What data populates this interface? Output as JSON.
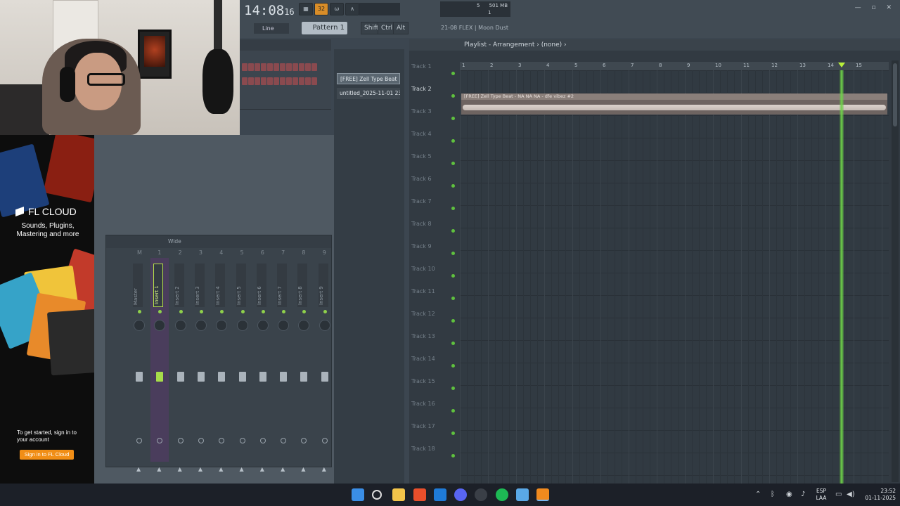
{
  "toolbar": {
    "time": "14:08",
    "time_small": "16",
    "tempo_label": "32",
    "memory": "501 MB",
    "memory_sub_1": "5",
    "memory_sub_2": "1",
    "snap": "Line",
    "pattern": "Pattern 1",
    "keys": [
      "Shift",
      "Ctrl",
      "Alt"
    ],
    "hint": "21-08  FLEX | Moon Dust"
  },
  "playlist": {
    "title": "Playlist - Arrangement",
    "subtitle": "(none)",
    "bars": [
      "1",
      "2",
      "3",
      "4",
      "5",
      "6",
      "7",
      "8",
      "9",
      "10",
      "11",
      "12",
      "13",
      "14",
      "15"
    ],
    "tracks": [
      "Track 1",
      "Track 2",
      "Track 3",
      "Track 4",
      "Track 5",
      "Track 6",
      "Track 7",
      "Track 8",
      "Track 9",
      "Track 10",
      "Track 11",
      "Track 12",
      "Track 13",
      "Track 14",
      "Track 15",
      "Track 16",
      "Track 17",
      "Track 18"
    ],
    "clip_title": "[FREE] Zell Type Beat - NA NA NA - dfe vibez #2"
  },
  "browser": {
    "items": [
      "[FREE] Zell Type Beat",
      "untitled_2025-11-01 23-"
    ]
  },
  "mixer": {
    "mode": "Wide",
    "strips": [
      {
        "num": "M",
        "name": "Master"
      },
      {
        "num": "1",
        "name": "Insert 1"
      },
      {
        "num": "2",
        "name": "Insert 2"
      },
      {
        "num": "3",
        "name": "Insert 3"
      },
      {
        "num": "4",
        "name": "Insert 4"
      },
      {
        "num": "5",
        "name": "Insert 5"
      },
      {
        "num": "6",
        "name": "Insert 6"
      },
      {
        "num": "7",
        "name": "Insert 7"
      },
      {
        "num": "8",
        "name": "Insert 8"
      },
      {
        "num": "9",
        "name": "Insert 9"
      }
    ]
  },
  "ad": {
    "logo": "FL CLOUD",
    "tagline": "Sounds, Plugins, Mastering and more",
    "prompt": "To get started, sign in to your account",
    "button": "Sign in to FL Cloud"
  },
  "taskbar": {
    "lang_1": "ESP",
    "lang_2": "LAA",
    "clock": "23:52",
    "date": "01-11-2025"
  }
}
